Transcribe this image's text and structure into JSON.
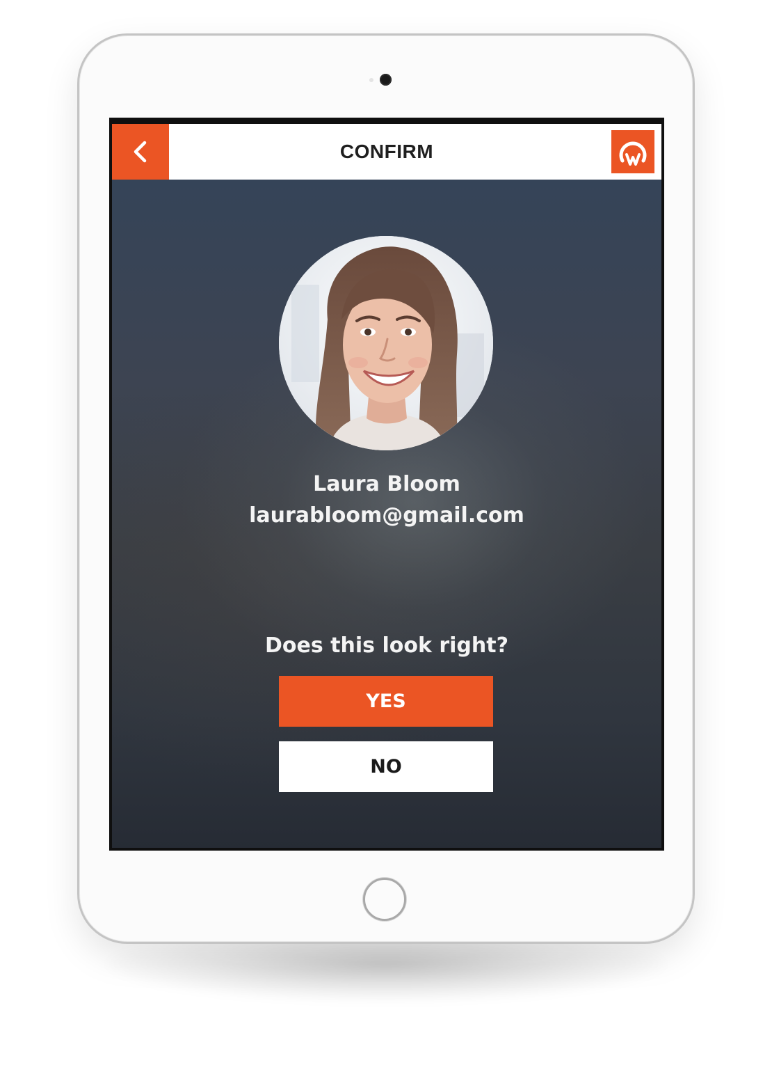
{
  "app": {
    "title": "CONFIRM",
    "back_icon": "chevron-left-icon",
    "logo_icon": "app-logo-icon",
    "accent_color": "#eb5524"
  },
  "profile": {
    "name": "Laura Bloom",
    "email": "laurabloom@gmail.com",
    "avatar_icon": "profile-photo"
  },
  "confirm": {
    "question": "Does this look right?",
    "yes_label": "YES",
    "no_label": "NO"
  }
}
